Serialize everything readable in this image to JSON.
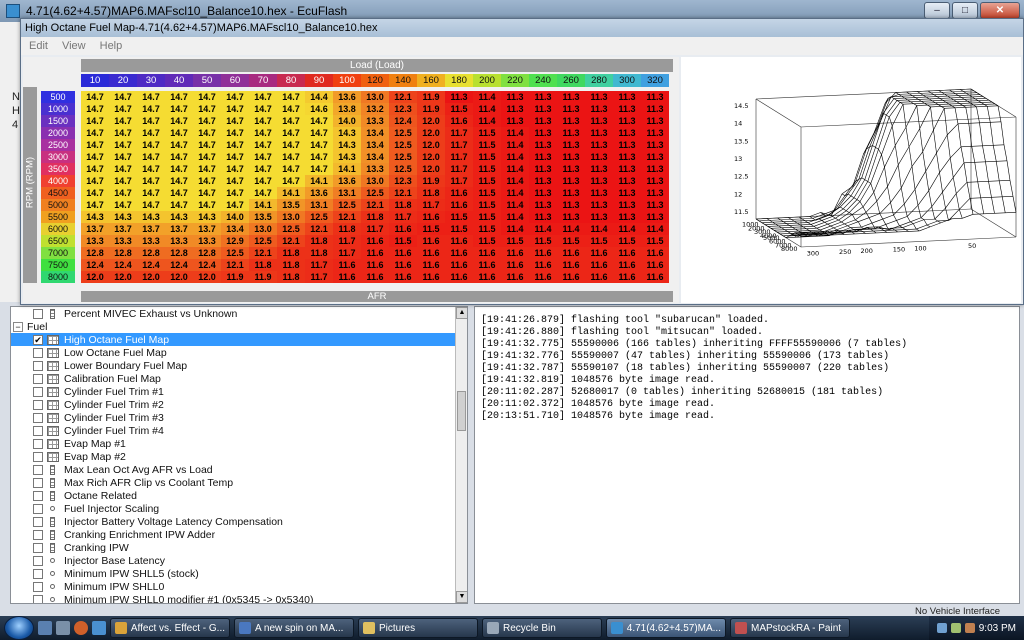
{
  "main_window": {
    "title": "4.71(4.62+4.57)MAP6.MAFscl10_Balance10.hex - EcuFlash",
    "left_stub_text": [
      "N",
      "H",
      "4"
    ]
  },
  "map_window": {
    "title": "High Octane Fuel Map-4.71(4.62+4.57)MAP6.MAFscl10_Balance10.hex",
    "menu": [
      "Edit",
      "View",
      "Help"
    ],
    "load_header": "Load (Load)",
    "rpm_label": "RPM (RPM)",
    "afr_footer": "AFR",
    "x_axis": [
      "10",
      "20",
      "30",
      "40",
      "50",
      "60",
      "70",
      "80",
      "90",
      "100",
      "120",
      "140",
      "160",
      "180",
      "200",
      "220",
      "240",
      "260",
      "280",
      "300",
      "320"
    ],
    "x_axis_colors": [
      "#2a2ad8",
      "#3a2ad0",
      "#4e2ac4",
      "#602ab8",
      "#7830a8",
      "#903098",
      "#a82a80",
      "#c82a50",
      "#e02a20",
      "#f04010",
      "#f06010",
      "#f08010",
      "#f0b020",
      "#e8e030",
      "#b8e030",
      "#80e040",
      "#50e050",
      "#40d860",
      "#40d0a0",
      "#40b8d0",
      "#40a0e0"
    ],
    "y_axis": [
      "500",
      "1000",
      "1500",
      "2000",
      "2500",
      "3000",
      "3500",
      "4000",
      "4500",
      "5000",
      "5500",
      "6000",
      "6500",
      "7000",
      "7500",
      "8000"
    ],
    "y_axis_colors": [
      "#3030e0",
      "#4a30d0",
      "#6a30c0",
      "#8a30b0",
      "#a830a0",
      "#c83080",
      "#e03060",
      "#f04030",
      "#f06020",
      "#f08020",
      "#f0a020",
      "#e8d030",
      "#c0e030",
      "#80e040",
      "#40e040",
      "#30d870"
    ],
    "grid": [
      [
        "14.7",
        "14.7",
        "14.7",
        "14.7",
        "14.7",
        "14.7",
        "14.7",
        "14.7",
        "14.4",
        "13.6",
        "13.0",
        "12.1",
        "11.9",
        "11.3",
        "11.4",
        "11.3",
        "11.3",
        "11.3",
        "11.3",
        "11.3",
        "11.3"
      ],
      [
        "14.7",
        "14.7",
        "14.7",
        "14.7",
        "14.7",
        "14.7",
        "14.7",
        "14.7",
        "14.6",
        "13.8",
        "13.2",
        "12.3",
        "11.9",
        "11.5",
        "11.4",
        "11.3",
        "11.3",
        "11.3",
        "11.3",
        "11.3",
        "11.3"
      ],
      [
        "14.7",
        "14.7",
        "14.7",
        "14.7",
        "14.7",
        "14.7",
        "14.7",
        "14.7",
        "14.7",
        "14.0",
        "13.3",
        "12.4",
        "12.0",
        "11.6",
        "11.4",
        "11.3",
        "11.3",
        "11.3",
        "11.3",
        "11.3",
        "11.3"
      ],
      [
        "14.7",
        "14.7",
        "14.7",
        "14.7",
        "14.7",
        "14.7",
        "14.7",
        "14.7",
        "14.7",
        "14.3",
        "13.4",
        "12.5",
        "12.0",
        "11.7",
        "11.5",
        "11.4",
        "11.3",
        "11.3",
        "11.3",
        "11.3",
        "11.3"
      ],
      [
        "14.7",
        "14.7",
        "14.7",
        "14.7",
        "14.7",
        "14.7",
        "14.7",
        "14.7",
        "14.7",
        "14.3",
        "13.4",
        "12.5",
        "12.0",
        "11.7",
        "11.5",
        "11.4",
        "11.3",
        "11.3",
        "11.3",
        "11.3",
        "11.3"
      ],
      [
        "14.7",
        "14.7",
        "14.7",
        "14.7",
        "14.7",
        "14.7",
        "14.7",
        "14.7",
        "14.7",
        "14.3",
        "13.4",
        "12.5",
        "12.0",
        "11.7",
        "11.5",
        "11.4",
        "11.3",
        "11.3",
        "11.3",
        "11.3",
        "11.3"
      ],
      [
        "14.7",
        "14.7",
        "14.7",
        "14.7",
        "14.7",
        "14.7",
        "14.7",
        "14.7",
        "14.7",
        "14.1",
        "13.3",
        "12.5",
        "12.0",
        "11.7",
        "11.5",
        "11.4",
        "11.3",
        "11.3",
        "11.3",
        "11.3",
        "11.3"
      ],
      [
        "14.7",
        "14.7",
        "14.7",
        "14.7",
        "14.7",
        "14.7",
        "14.7",
        "14.7",
        "14.1",
        "13.6",
        "13.0",
        "12.3",
        "11.9",
        "11.7",
        "11.5",
        "11.4",
        "11.3",
        "11.3",
        "11.3",
        "11.3",
        "11.3"
      ],
      [
        "14.7",
        "14.7",
        "14.7",
        "14.7",
        "14.7",
        "14.7",
        "14.7",
        "14.1",
        "13.6",
        "13.1",
        "12.5",
        "12.1",
        "11.8",
        "11.6",
        "11.5",
        "11.4",
        "11.3",
        "11.3",
        "11.3",
        "11.3",
        "11.3"
      ],
      [
        "14.7",
        "14.7",
        "14.7",
        "14.7",
        "14.7",
        "14.7",
        "14.1",
        "13.5",
        "13.1",
        "12.5",
        "12.1",
        "11.8",
        "11.7",
        "11.6",
        "11.5",
        "11.4",
        "11.3",
        "11.3",
        "11.3",
        "11.3",
        "11.3"
      ],
      [
        "14.3",
        "14.3",
        "14.3",
        "14.3",
        "14.3",
        "14.0",
        "13.5",
        "13.0",
        "12.5",
        "12.1",
        "11.8",
        "11.7",
        "11.6",
        "11.5",
        "11.5",
        "11.4",
        "11.3",
        "11.3",
        "11.3",
        "11.3",
        "11.3"
      ],
      [
        "13.7",
        "13.7",
        "13.7",
        "13.7",
        "13.7",
        "13.4",
        "13.0",
        "12.5",
        "12.1",
        "11.8",
        "11.7",
        "11.6",
        "11.5",
        "11.5",
        "11.5",
        "11.4",
        "11.4",
        "11.4",
        "11.4",
        "11.4",
        "11.4"
      ],
      [
        "13.3",
        "13.3",
        "13.3",
        "13.3",
        "13.3",
        "12.9",
        "12.5",
        "12.1",
        "11.8",
        "11.7",
        "11.6",
        "11.5",
        "11.6",
        "11.6",
        "11.5",
        "11.5",
        "11.5",
        "11.5",
        "11.5",
        "11.5",
        "11.5"
      ],
      [
        "12.8",
        "12.8",
        "12.8",
        "12.8",
        "12.8",
        "12.5",
        "12.1",
        "11.8",
        "11.8",
        "11.7",
        "11.6",
        "11.6",
        "11.6",
        "11.6",
        "11.6",
        "11.6",
        "11.6",
        "11.6",
        "11.6",
        "11.6",
        "11.6"
      ],
      [
        "12.4",
        "12.4",
        "12.4",
        "12.4",
        "12.4",
        "12.1",
        "11.8",
        "11.8",
        "11.7",
        "11.6",
        "11.6",
        "11.6",
        "11.6",
        "11.6",
        "11.6",
        "11.6",
        "11.6",
        "11.6",
        "11.6",
        "11.6",
        "11.6"
      ],
      [
        "12.0",
        "12.0",
        "12.0",
        "12.0",
        "12.0",
        "11.9",
        "11.9",
        "11.8",
        "11.7",
        "11.6",
        "11.6",
        "11.6",
        "11.6",
        "11.6",
        "11.6",
        "11.6",
        "11.6",
        "11.6",
        "11.6",
        "11.6",
        "11.6"
      ]
    ],
    "plot_z_ticks": [
      "14.5",
      "14",
      "13.5",
      "13",
      "12.5",
      "12",
      "11.5"
    ],
    "plot_rpm_ticks": [
      "1000",
      "2000",
      "3000",
      "4000",
      "5000",
      "6000",
      "7000",
      "8000"
    ],
    "plot_load_ticks": [
      "300",
      "250",
      "200",
      "150",
      "100",
      "50"
    ]
  },
  "tree": {
    "rows": [
      {
        "label": "Percent MIVEC Exhaust vs Unknown",
        "type": "vec",
        "level": 1,
        "checked": false,
        "selected": false
      },
      {
        "label": "Fuel",
        "type": "group",
        "level": 0,
        "expander": "−"
      },
      {
        "label": "High Octane Fuel Map",
        "type": "table",
        "level": 1,
        "checked": true,
        "selected": true
      },
      {
        "label": "Low Octane Fuel Map",
        "type": "table",
        "level": 1,
        "checked": false,
        "selected": false
      },
      {
        "label": "Lower Boundary Fuel Map",
        "type": "table",
        "level": 1,
        "checked": false,
        "selected": false
      },
      {
        "label": "Calibration Fuel Map",
        "type": "table",
        "level": 1,
        "checked": false,
        "selected": false
      },
      {
        "label": "Cylinder Fuel Trim #1",
        "type": "table",
        "level": 1,
        "checked": false,
        "selected": false
      },
      {
        "label": "Cylinder Fuel Trim #2",
        "type": "table",
        "level": 1,
        "checked": false,
        "selected": false
      },
      {
        "label": "Cylinder Fuel Trim #3",
        "type": "table",
        "level": 1,
        "checked": false,
        "selected": false
      },
      {
        "label": "Cylinder Fuel Trim #4",
        "type": "table",
        "level": 1,
        "checked": false,
        "selected": false
      },
      {
        "label": "Evap Map #1",
        "type": "table",
        "level": 1,
        "checked": false,
        "selected": false
      },
      {
        "label": "Evap Map #2",
        "type": "table",
        "level": 1,
        "checked": false,
        "selected": false
      },
      {
        "label": "Max Lean Oct Avg AFR vs Load",
        "type": "vec",
        "level": 1,
        "checked": false,
        "selected": false
      },
      {
        "label": "Max Rich AFR Clip vs Coolant Temp",
        "type": "vec",
        "level": 1,
        "checked": false,
        "selected": false
      },
      {
        "label": "Octane Related",
        "type": "vec",
        "level": 1,
        "checked": false,
        "selected": false
      },
      {
        "label": "Fuel Injector Scaling",
        "type": "dot",
        "level": 1,
        "checked": false,
        "selected": false
      },
      {
        "label": "Injector Battery Voltage Latency Compensation",
        "type": "vec",
        "level": 1,
        "checked": false,
        "selected": false
      },
      {
        "label": "Cranking Enrichment IPW Adder",
        "type": "vec",
        "level": 1,
        "checked": false,
        "selected": false
      },
      {
        "label": "Cranking IPW",
        "type": "vec",
        "level": 1,
        "checked": false,
        "selected": false
      },
      {
        "label": "Injector Base Latency",
        "type": "dot",
        "level": 1,
        "checked": false,
        "selected": false
      },
      {
        "label": "Minimum IPW SHLL5 (stock)",
        "type": "dot",
        "level": 1,
        "checked": false,
        "selected": false
      },
      {
        "label": "Minimum IPW SHLL0",
        "type": "dot",
        "level": 1,
        "checked": false,
        "selected": false
      },
      {
        "label": "Minimum IPW SHLL0 modifier #1 (0x5345 -> 0x5340)",
        "type": "dot",
        "level": 1,
        "checked": false,
        "selected": false
      }
    ]
  },
  "log": {
    "lines": [
      "[19:41:26.879] flashing tool \"subarucan\" loaded.",
      "[19:41:26.880] flashing tool \"mitsucan\" loaded.",
      "[19:41:32.775] 55590006 (166 tables) inheriting FFFF55590006 (7 tables)",
      "[19:41:32.776] 55590007 (47 tables) inheriting 55590006 (173 tables)",
      "[19:41:32.787] 55590107 (18 tables) inheriting 55590007 (220 tables)",
      "[19:41:32.819] 1048576 byte image read.",
      "[20:11:02.287] 52680017 (0 tables) inheriting 52680015 (181 tables)",
      "[20:11:02.372] 1048576 byte image read.",
      "[20:13:51.710] 1048576 byte image read."
    ]
  },
  "status": {
    "text": "No Vehicle Interface"
  },
  "taskbar": {
    "items": [
      {
        "label": "Affect vs. Effect - G...",
        "color": "#d9a33a",
        "active": false
      },
      {
        "label": "A new spin on MA...",
        "color": "#4a78c0",
        "active": false
      },
      {
        "label": "Pictures",
        "color": "#e0c060",
        "active": false
      },
      {
        "label": "Recycle Bin",
        "color": "#9aa8b8",
        "active": false
      },
      {
        "label": "4.71(4.62+4.57)MA...",
        "color": "#3a8fd0",
        "active": true
      },
      {
        "label": "MAPstockRA - Paint",
        "color": "#c05050",
        "active": false
      }
    ],
    "clock": "9:03 PM"
  }
}
